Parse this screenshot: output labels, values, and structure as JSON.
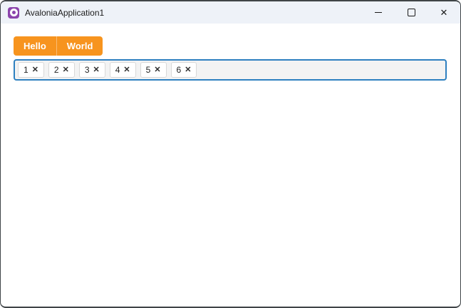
{
  "window": {
    "title": "AvaloniaApplication1",
    "controls": {
      "minimize_icon": "minimize-line",
      "maximize_icon": "maximize-square",
      "close_glyph": "✕"
    }
  },
  "toolbar": {
    "buttons": [
      {
        "label": "Hello"
      },
      {
        "label": "World"
      }
    ]
  },
  "tag_box": {
    "items": [
      {
        "label": "1"
      },
      {
        "label": "2"
      },
      {
        "label": "3"
      },
      {
        "label": "4"
      },
      {
        "label": "5"
      },
      {
        "label": "6"
      }
    ],
    "remove_glyph": "✕"
  },
  "colors": {
    "accent_orange": "#f7941e",
    "focus_border_blue": "#2e80c0",
    "titlebar_bg": "#eef2f8",
    "logo_purple": "#8b44ac",
    "window_border": "#3f4447"
  }
}
